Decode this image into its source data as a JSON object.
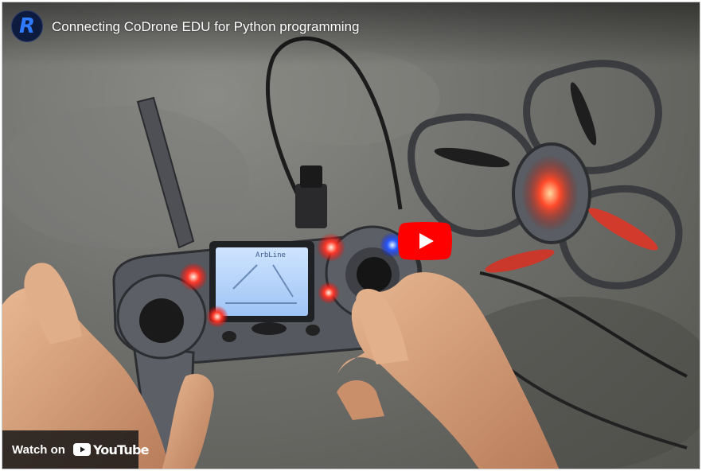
{
  "video": {
    "title": "Connecting CoDrone EDU for Python programming",
    "channel_avatar_letter": "R",
    "avatar_color": "#2f7bff",
    "play_button_color": "#ff0000"
  },
  "watch_bar": {
    "label": "Watch on",
    "brand": "YouTube"
  },
  "controller_screen": {
    "header_text": "ArbLine"
  },
  "icons": {
    "play": "play-icon",
    "youtube": "youtube-logo-icon"
  }
}
